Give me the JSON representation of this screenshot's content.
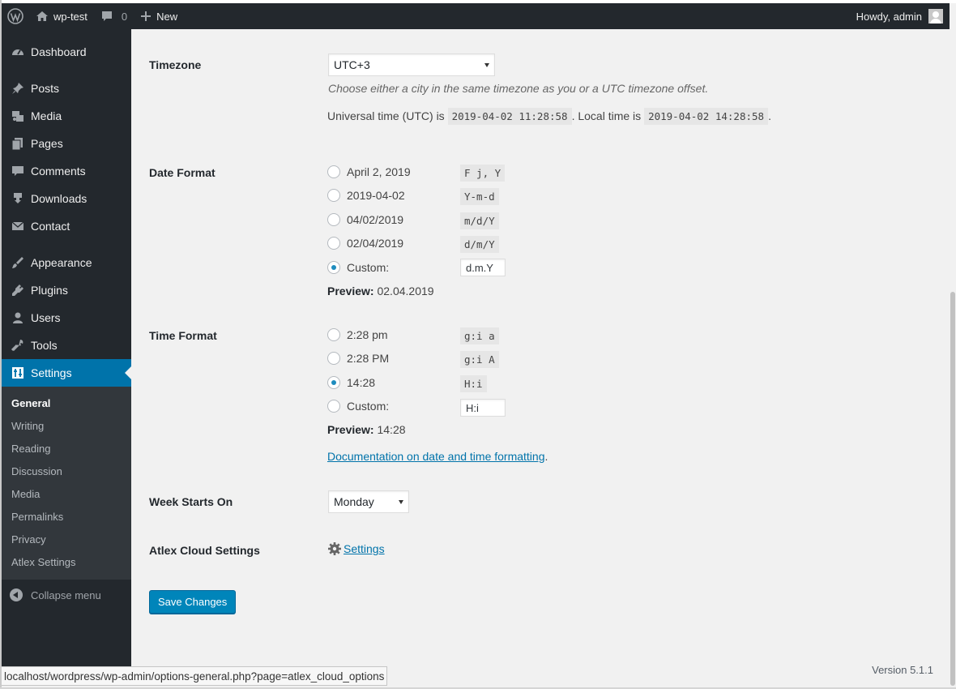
{
  "adminbar": {
    "site_name": "wp-test",
    "comments_count": "0",
    "new_label": "New",
    "howdy": "Howdy, admin"
  },
  "sidebar": {
    "items": [
      {
        "label": "Dashboard",
        "icon": "dashboard-icon"
      },
      {
        "label": "Posts",
        "icon": "pin-icon"
      },
      {
        "label": "Media",
        "icon": "media-icon"
      },
      {
        "label": "Pages",
        "icon": "pages-icon"
      },
      {
        "label": "Comments",
        "icon": "comment-icon"
      },
      {
        "label": "Downloads",
        "icon": "download-icon"
      },
      {
        "label": "Contact",
        "icon": "mail-icon"
      },
      {
        "label": "Appearance",
        "icon": "brush-icon"
      },
      {
        "label": "Plugins",
        "icon": "plugin-icon"
      },
      {
        "label": "Users",
        "icon": "user-icon"
      },
      {
        "label": "Tools",
        "icon": "wrench-icon"
      },
      {
        "label": "Settings",
        "icon": "settings-icon"
      }
    ],
    "submenu": [
      "General",
      "Writing",
      "Reading",
      "Discussion",
      "Media",
      "Permalinks",
      "Privacy",
      "Atlex Settings"
    ],
    "collapse": "Collapse menu"
  },
  "timezone": {
    "label": "Timezone",
    "value": "UTC+3",
    "description": "Choose either a city in the same timezone as you or a UTC timezone offset.",
    "utc_prefix": "Universal time (UTC) is",
    "utc_time": "2019-04-02 11:28:58",
    "local_prefix": ". Local time is",
    "local_time": "2019-04-02 14:28:58",
    "suffix": "."
  },
  "date_format": {
    "label": "Date Format",
    "options": [
      {
        "label": "April 2, 2019",
        "code": "F j, Y"
      },
      {
        "label": "2019-04-02",
        "code": "Y-m-d"
      },
      {
        "label": "04/02/2019",
        "code": "m/d/Y"
      },
      {
        "label": "02/04/2019",
        "code": "d/m/Y"
      },
      {
        "label": "Custom:",
        "code": ""
      }
    ],
    "selected": 4,
    "custom_value": "d.m.Y",
    "preview_label": "Preview:",
    "preview_value": "02.04.2019"
  },
  "time_format": {
    "label": "Time Format",
    "options": [
      {
        "label": "2:28 pm",
        "code": "g:i a"
      },
      {
        "label": "2:28 PM",
        "code": "g:i A"
      },
      {
        "label": "14:28",
        "code": "H:i"
      },
      {
        "label": "Custom:",
        "code": ""
      }
    ],
    "selected": 2,
    "custom_value": "H:i",
    "preview_label": "Preview:",
    "preview_value": "14:28",
    "doc_link": "Documentation on date and time formatting",
    "doc_suffix": "."
  },
  "week_starts": {
    "label": "Week Starts On",
    "value": "Monday"
  },
  "atlex": {
    "label": "Atlex Cloud Settings",
    "link": "Settings"
  },
  "save_button": "Save Changes",
  "version": "Version 5.1.1",
  "status_url": "localhost/wordpress/wp-admin/options-general.php?page=atlex_cloud_options",
  "colors": {
    "adminbar_bg": "#23282d",
    "accent": "#0073aa",
    "button": "#0085ba"
  }
}
